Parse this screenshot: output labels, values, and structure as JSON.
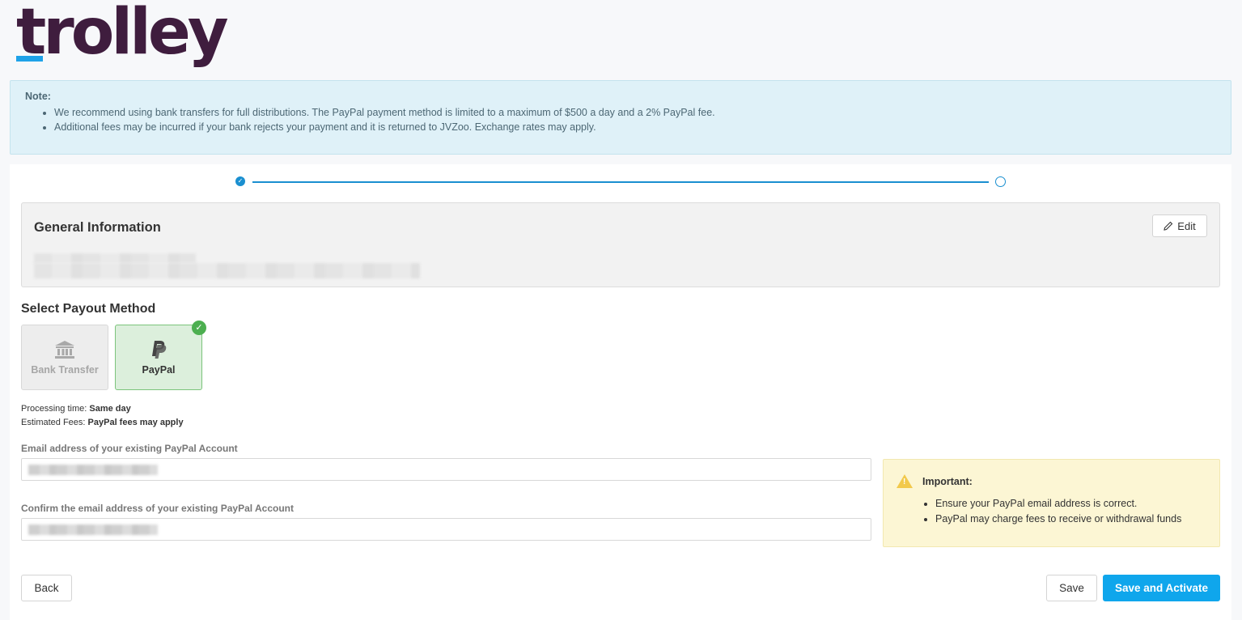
{
  "brand": {
    "logo_text": "trolley",
    "accent_color": "#1ea2e8",
    "logo_color": "#3f1d3e"
  },
  "note": {
    "title": "Note:",
    "items": [
      "We recommend using bank transfers for full distributions.  The PayPal payment method is limited to a maximum of $500 a day and a 2% PayPal fee.",
      "Additional fees may be incurred if your bank rejects your payment and it is returned to JVZoo.  Exchange rates may apply."
    ]
  },
  "stepper": {
    "current_step": 1,
    "total_steps": 2
  },
  "general_info": {
    "title": "General Information",
    "edit_label": "Edit"
  },
  "payout": {
    "title": "Select Payout Method",
    "methods": [
      {
        "label": "Bank Transfer",
        "icon": "bank-icon",
        "selected": false
      },
      {
        "label": "PayPal",
        "icon": "paypal-icon",
        "selected": true
      }
    ],
    "processing_label": "Processing time: ",
    "processing_value": "Same day",
    "fees_label": "Estimated Fees: ",
    "fees_value": "PayPal fees may apply"
  },
  "form": {
    "email_label": "Email address of your existing PayPal Account",
    "confirm_label": "Confirm the email address of your existing PayPal Account"
  },
  "important": {
    "title": "Important:",
    "items": [
      "Ensure your PayPal email address is correct.",
      "PayPal may charge fees to receive or withdrawal funds"
    ]
  },
  "buttons": {
    "back": "Back",
    "save": "Save",
    "save_activate": "Save and Activate"
  }
}
